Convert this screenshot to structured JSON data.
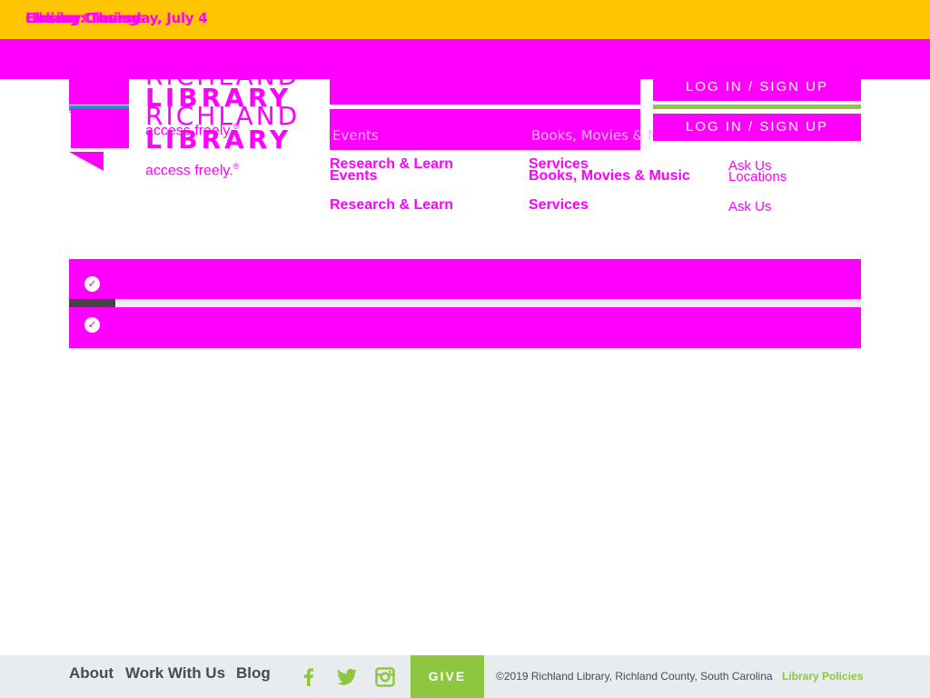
{
  "alert": {
    "layer1": "Closing: Thursday, July 4",
    "layer2": "Holiday Closing",
    "layer3": "Library Closings"
  },
  "logo": {
    "word1": "RICHLAND",
    "word2": "LIBRARY",
    "tagline": "access freely.",
    "tag_mark": "®"
  },
  "login": {
    "label": "LOG IN / SIGN UP"
  },
  "nav": {
    "ghost_events": "Events",
    "ghost_books": "Books, Movies & Music",
    "items": [
      {
        "label": "Research & Learn"
      },
      {
        "label": "Events"
      },
      {
        "label": "Research & Learn"
      },
      {
        "label": "Services"
      },
      {
        "label": "Books, Movies & Music"
      },
      {
        "label": "Services"
      },
      {
        "label": "Ask Us"
      },
      {
        "label": "Locations"
      },
      {
        "label": "Ask Us"
      }
    ]
  },
  "notices": {
    "progress_fraction": 0.058
  },
  "footer": {
    "links": [
      "About",
      "Work With Us",
      "Blog"
    ],
    "social_icons": [
      "facebook-icon",
      "twitter-icon",
      "instagram-icon"
    ],
    "give": "GIVE",
    "copyright": "©2019 Richland Library, Richland County, South Carolina",
    "policies": "Library Policies"
  },
  "colors": {
    "alert_bg": "#ffc600",
    "accent": "#ff00ff",
    "brand_green": "#8dc63f",
    "footer_bg": "#e8ecef",
    "footer_text": "#444c56"
  }
}
